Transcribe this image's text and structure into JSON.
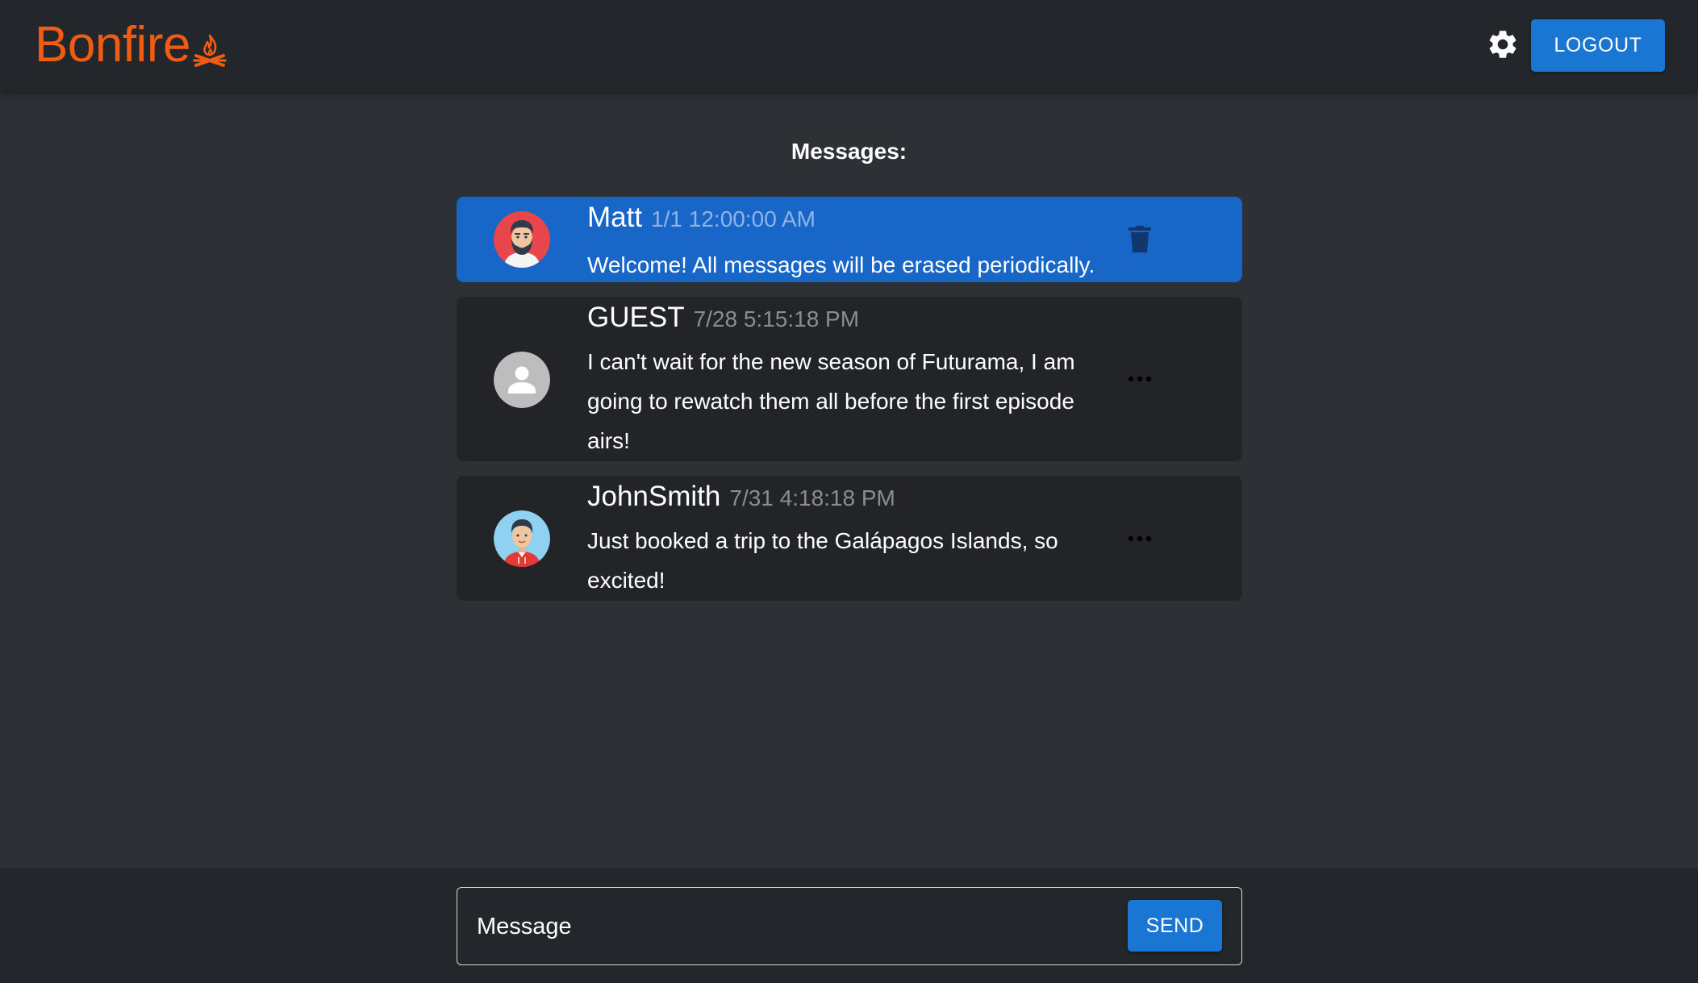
{
  "header": {
    "brand": "Bonfire",
    "brand_color": "#f25c12",
    "brand_icon": "campfire-icon",
    "settings_icon": "gear-icon",
    "logout_label": "LOGOUT",
    "accent": "#1976d2"
  },
  "main": {
    "heading": "Messages:",
    "messages": [
      {
        "author": "Matt",
        "time": "1/1 12:00:00 AM",
        "text": "Welcome! All messages will be erased periodically.",
        "avatar": "bearded-man-avatar",
        "highlighted": true,
        "action_icon": "trash-icon"
      },
      {
        "author": "GUEST",
        "time": "7/28 5:15:18 PM",
        "text": "I can't wait for the new season of Futurama, I am going to rewatch them all before the first episode airs!",
        "avatar": "default-user-avatar",
        "highlighted": false,
        "action_icon": "more-options-icon"
      },
      {
        "author": "JohnSmith",
        "time": "7/31 4:18:18 PM",
        "text": "Just booked a trip to the Galápagos Islands, so excited!",
        "avatar": "young-man-avatar",
        "highlighted": false,
        "action_icon": "more-options-icon"
      }
    ]
  },
  "composer": {
    "placeholder": "Message",
    "send_label": "SEND"
  }
}
